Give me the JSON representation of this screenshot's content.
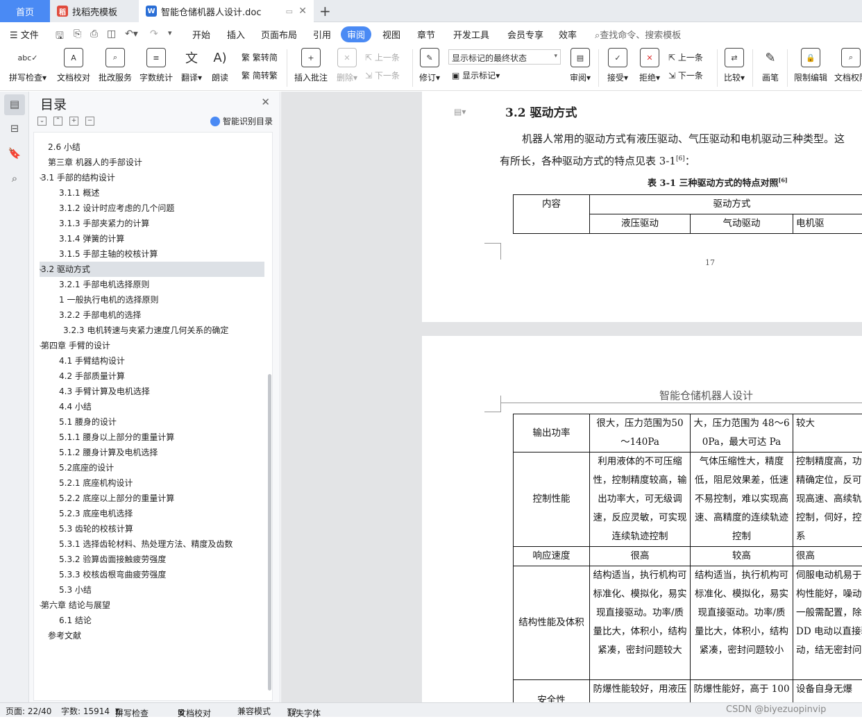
{
  "tabs": {
    "home": "首页",
    "template": "找稻壳模板",
    "doc": "智能仓储机器人设计.doc"
  },
  "menu": {
    "file": "文件",
    "items": [
      "开始",
      "插入",
      "页面布局",
      "引用",
      "审阅",
      "视图",
      "章节",
      "开发工具",
      "会员专享",
      "效率"
    ],
    "search": "查找命令、搜索模板"
  },
  "ribbon": {
    "spell": "拼写检查",
    "doc_check": "文档校对",
    "batch": "批改服务",
    "word_count": "字数统计",
    "translate": "翻译",
    "read": "朗读",
    "trad": "繁转简",
    "simp": "简转繁",
    "insert_comment": "插入批注",
    "delete": "删除",
    "prev": "上一条",
    "next": "下一条",
    "revise": "修订",
    "markup_state": "显示标记的最终状态",
    "show_markup": "显示标记",
    "review": "审阅",
    "accept": "接受",
    "reject": "拒绝",
    "prev2": "上一条",
    "next2": "下一条",
    "compare": "比较",
    "pen": "画笔",
    "restrict": "限制编辑",
    "doc_perm": "文档权限"
  },
  "toc": {
    "title": "目录",
    "smart": "智能识别目录",
    "items": [
      "2.6  小结",
      "第三章   机器人的手部设计",
      "3.1  手部的结构设计",
      "3.1.1  概述",
      "3.1.2  设计时应考虑的几个问题",
      "3.1.3  手部夹紧力的计算",
      "3.1.4  弹簧的计算",
      "3.1.5  手部主轴的校核计算",
      "3.2  驱动方式",
      "3.2.1  手部电机选择原则",
      "1  一般执行电机的选择原则",
      "3.2.2  手部电机的选择",
      "3.2.3  电机转速与夹紧力速度几何关系的确定",
      "第四章    手臂的设计",
      "4.1  手臂结构设计",
      "4.2  手部质量计算",
      "4.3  手臂计算及电机选择",
      "4.4    小结",
      "5.1  腰身的设计",
      "5.1.1  腰身以上部分的重量计算",
      "5.1.2  腰身计算及电机选择",
      "5.2底座的设计",
      "5.2.1  底座机构设计",
      "5.2.2  底座以上部分的重量计算",
      "5.2.3  底座电机选择",
      "5.3  齿轮的校核计算",
      "5.3.1  选择齿轮材料、热处理方法、精度及齿数",
      "5.3.2  验算齿面接触疲劳强度",
      "5.3.3  校核齿根弯曲疲劳强度",
      "5.3      小结",
      "第六章  结论与展望",
      "6.1  结论",
      "参考文献"
    ]
  },
  "page1": {
    "heading": "3.2  驱动方式",
    "para_line1": "机器人常用的驱动方式有液压驱动、气压驱动和电机驱动三种类型。这",
    "para_line2a": "有所长，各种驱动方式的特点见表 3-1",
    "para_ref": "[6]",
    "para_line2b": "：",
    "table_caption": "表 3-1 三种驱动方式的特点对照",
    "caption_ref": "[6]",
    "header_col1": "内容",
    "header_group": "驱动方式",
    "sub_headers": [
      "液压驱动",
      "气动驱动",
      "电机驱"
    ],
    "page_number": "17"
  },
  "page2": {
    "header": "智能仓储机器人设计",
    "rows": [
      {
        "label": "输出功率",
        "c1": "很大，压力范围为50～140Pa",
        "c2": "大，压力范围为 48～60Pa，最大可达 Pa",
        "c3": "较大"
      },
      {
        "label": "控制性能",
        "c1": "利用液体的不可压缩性，控制精度较高，输出功率大，可无级调速，反应灵敏，可实现连续轨迹控制",
        "c2": "气体压缩性大，精度低，阻尼效果差，低速不易控制，难以实现高速、高精度的连续轨迹控制",
        "c3": "控制精度高，功能精确定位，反可实现高速、高续轨迹控制，伺好，控制系"
      },
      {
        "label": "响应速度",
        "c1": "很高",
        "c2": "较高",
        "c3": "很高"
      },
      {
        "label": "结构性能及体积",
        "c1": "结构适当，执行机构可标准化、模拟化，易实现直接驱动。功率/质量比大，体积小，结构紧凑，密封问题较大",
        "c2": "结构适当，执行机构可标准化、模拟化，易实现直接驱动。功率/质量比大，体积小，结构紧凑，密封问题较小",
        "c3": "伺服电动机易于结构性能好，噪动机一般需配置，除 DD 电动以直接驱动，结无密封问"
      },
      {
        "label": "安全性",
        "c1": "防爆性能较好，用液压油作传动介质，有",
        "c2": "防爆性能好，高于 1000kPa 时应注意",
        "c3": "设备自身无爆"
      }
    ]
  },
  "status": {
    "page": "页面: 22/40",
    "words": "字数: 15914",
    "spell": "拼写检查",
    "doc_check": "文档校对",
    "compat": "兼容模式",
    "missing_font": "缺失字体",
    "watermark": "CSDN @biyezuopinvip"
  }
}
